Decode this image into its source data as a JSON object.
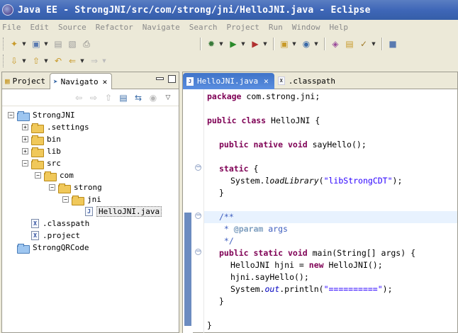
{
  "window": {
    "title": "Java EE - StrongJNI/src/com/strong/jni/HelloJNI.java - Eclipse"
  },
  "menu": [
    "File",
    "Edit",
    "Source",
    "Refactor",
    "Navigate",
    "Search",
    "Project",
    "Run",
    "Window",
    "Help"
  ],
  "left_view": {
    "tabs": [
      {
        "label": "Project",
        "icon": "project-explorer-icon"
      },
      {
        "label": "Navigato",
        "icon": "navigator-icon"
      }
    ],
    "tree": [
      {
        "label": "StrongJNI",
        "icon": "project-folder-icon",
        "expanded": true
      },
      {
        "label": ".settings",
        "icon": "folder-icon",
        "expanded": false
      },
      {
        "label": "bin",
        "icon": "folder-icon",
        "expanded": false
      },
      {
        "label": "lib",
        "icon": "folder-icon",
        "expanded": false
      },
      {
        "label": "src",
        "icon": "folder-icon",
        "expanded": true
      },
      {
        "label": "com",
        "icon": "folder-icon",
        "expanded": true
      },
      {
        "label": "strong",
        "icon": "folder-icon",
        "expanded": true
      },
      {
        "label": "jni",
        "icon": "folder-icon",
        "expanded": true
      },
      {
        "label": "HelloJNI.java",
        "icon": "java-file-icon",
        "selected": true
      },
      {
        "label": ".classpath",
        "icon": "xml-file-icon"
      },
      {
        "label": ".project",
        "icon": "xml-file-icon"
      },
      {
        "label": "StrongQRCode",
        "icon": "project-folder-icon",
        "expanded": false
      }
    ]
  },
  "editor": {
    "tabs": [
      {
        "label": "HelloJNI.java",
        "active": true
      },
      {
        "label": ".classpath",
        "active": false
      }
    ],
    "code": {
      "l1_kw": "package",
      "l1_rest": " com.strong.jni;",
      "l2_kw1": "public",
      "l2_kw2": "class",
      "l2_rest": " HelloJNI {",
      "l3_kw1": "public",
      "l3_kw2": "native",
      "l3_kw3": "void",
      "l3_rest": " sayHello();",
      "l4_kw": "static",
      "l4_rest": " {",
      "l5_a": "System.",
      "l5_m": "loadLibrary",
      "l5_b": "(",
      "l5_str": "\"libStrongCDT\"",
      "l5_c": ");",
      "l6": "}",
      "l7": "/**",
      "l8_a": " * ",
      "l8_tag": "@param",
      "l8_b": " args",
      "l9": " */",
      "l10_kw1": "public",
      "l10_kw2": "static",
      "l10_kw3": "void",
      "l10_rest": " main(String[] args) {",
      "l11_a": "HelloJNI hjni = ",
      "l11_kw": "new",
      "l11_b": " HelloJNI();",
      "l12": "hjni.sayHello();",
      "l13_a": "System.",
      "l13_f": "out",
      "l13_b": ".println(",
      "l13_str": "\"==========\"",
      "l13_c": ");",
      "l14": "}",
      "l15": "}"
    }
  },
  "colors": {
    "title_bar": "#3f67b8",
    "keyword": "#7f0055",
    "string": "#2a00ff",
    "comment": "#3f5fbf",
    "active_tab": "#3f73c8"
  }
}
